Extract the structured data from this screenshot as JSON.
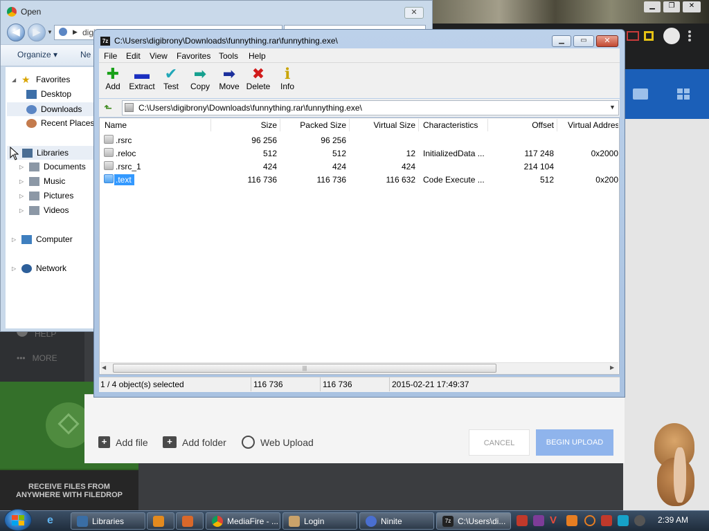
{
  "open_dialog": {
    "title": "Open",
    "address": "digi",
    "toolbar": {
      "organize": "Organize ▾",
      "new_folder": "Ne"
    },
    "tree": [
      {
        "label": "Favorites"
      },
      {
        "label": "Desktop"
      },
      {
        "label": "Downloads"
      },
      {
        "label": "Recent Places"
      },
      {
        "label": "Libraries"
      },
      {
        "label": "Documents"
      },
      {
        "label": "Music"
      },
      {
        "label": "Pictures"
      },
      {
        "label": "Videos"
      },
      {
        "label": "Computer"
      },
      {
        "label": "Network"
      }
    ]
  },
  "zip": {
    "title": "C:\\Users\\digibrony\\Downloads\\funnything.rar\\funnything.exe\\",
    "icon_label": "7z",
    "menu": [
      "File",
      "Edit",
      "View",
      "Favorites",
      "Tools",
      "Help"
    ],
    "toolbar": [
      {
        "label": "Add",
        "icon": "plus-icon",
        "glyph": "✚",
        "color": "#19a119"
      },
      {
        "label": "Extract",
        "icon": "minus-icon",
        "glyph": "▬",
        "color": "#1a2fc0"
      },
      {
        "label": "Test",
        "icon": "check-icon",
        "glyph": "✔",
        "color": "#21a7b8"
      },
      {
        "label": "Copy",
        "icon": "copy-arrow-icon",
        "glyph": "➡",
        "color": "#16a08f"
      },
      {
        "label": "Move",
        "icon": "move-arrow-icon",
        "glyph": "➡",
        "color": "#1b2f9c"
      },
      {
        "label": "Delete",
        "icon": "delete-x-icon",
        "glyph": "✖",
        "color": "#d11b1b"
      },
      {
        "label": "Info",
        "icon": "info-icon",
        "glyph": "ℹ",
        "color": "#c9a400"
      }
    ],
    "address": "C:\\Users\\digibrony\\Downloads\\funnything.rar\\funnything.exe\\",
    "columns": [
      "Name",
      "Size",
      "Packed Size",
      "Virtual Size",
      "Characteristics",
      "Offset",
      "Virtual Addres"
    ],
    "rows": [
      {
        "name": ".rsrc",
        "size": "96 256",
        "packed": "96 256",
        "vsize": "",
        "chars": "",
        "offset": "",
        "vaddr": ""
      },
      {
        "name": ".reloc",
        "size": "512",
        "packed": "512",
        "vsize": "12",
        "chars": "InitializedData ...",
        "offset": "117 248",
        "vaddr": "0x2000"
      },
      {
        "name": ".rsrc_1",
        "size": "424",
        "packed": "424",
        "vsize": "424",
        "chars": "",
        "offset": "214 104",
        "vaddr": ""
      },
      {
        "name": ".text",
        "size": "116 736",
        "packed": "116 736",
        "vsize": "116 632",
        "chars": "Code Execute ...",
        "offset": "512",
        "vaddr": "0x200"
      }
    ],
    "selected_row": 3,
    "status": {
      "selection": "1 / 4 object(s) selected",
      "size": "116 736",
      "packed": "116 736",
      "modified": "2015-02-21 17:49:37"
    }
  },
  "mediafire": {
    "nav_more": "MORE",
    "nav_help": "HELP",
    "receive_text": "RECEIVE FILES FROM ANYWHERE WITH FILEDROP",
    "upload": {
      "add_file": "Add file",
      "add_folder": "Add folder",
      "web_upload": "Web Upload",
      "cancel": "CANCEL",
      "begin": "BEGIN UPLOAD"
    }
  },
  "taskbar": {
    "tasks": [
      {
        "label": "Libraries",
        "color": "#3a6ea5"
      },
      {
        "label": "",
        "color": "#e38a1e"
      },
      {
        "label": "",
        "color": "#d9682a"
      },
      {
        "label": "MediaFire - ...",
        "color": "#e0a21c"
      },
      {
        "label": "Login",
        "color": "#c9a26a"
      },
      {
        "label": "Ninite",
        "color": "#4a6fd0"
      },
      {
        "label": "C:\\Users\\di...",
        "color": "#222222"
      }
    ],
    "tray_colors": [
      "#c0392b",
      "#7d3c98",
      "#e74c3c",
      "#e67e22",
      "#c0392b",
      "#16a2c9",
      "#555555"
    ],
    "clock": "2:39 AM"
  }
}
